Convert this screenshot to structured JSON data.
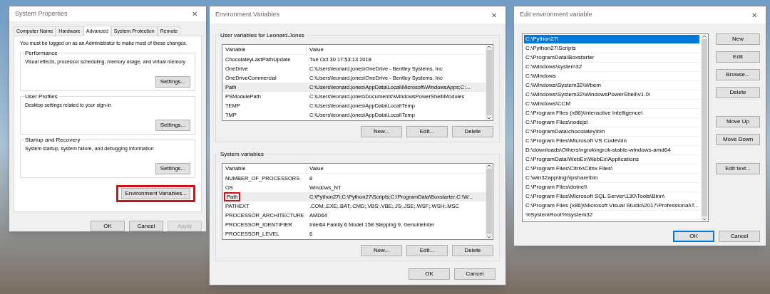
{
  "system_properties": {
    "title": "System Properties",
    "close": "✕",
    "tabs": [
      {
        "label": "Computer Name",
        "selected": false
      },
      {
        "label": "Hardware",
        "selected": false
      },
      {
        "label": "Advanced",
        "selected": true
      },
      {
        "label": "System Protection",
        "selected": false
      },
      {
        "label": "Remote",
        "selected": false
      }
    ],
    "note": "You must be logged on as an Administrator to make most of these changes.",
    "groups": [
      {
        "title": "Performance",
        "description": "Visual effects, processor scheduling, memory usage, and virtual memory",
        "button": "Settings..."
      },
      {
        "title": "User Profiles",
        "description": "Desktop settings related to your sign-in",
        "button": "Settings..."
      },
      {
        "title": "Startup and Recovery",
        "description": "System startup, system failure, and debugging information",
        "button": "Settings..."
      }
    ],
    "env_button": {
      "label": "Environment Variables...",
      "highlighted": true
    },
    "buttons": [
      {
        "label": "OK",
        "disabled": false
      },
      {
        "label": "Cancel",
        "disabled": false
      },
      {
        "label": "Apply",
        "disabled": true
      }
    ]
  },
  "environment_variables": {
    "title": "Environment Variables",
    "close": "✕",
    "sections": [
      {
        "title": "User variables for Leonard.Jones",
        "columns": [
          "Variable",
          "Value"
        ],
        "rows": [
          {
            "variable": "ChocolateyLastPathUpdate",
            "value": "Tue Oct 30 17:53:13 2018",
            "selected": false,
            "highlighted": false
          },
          {
            "variable": "OneDrive",
            "value": "C:\\Users\\leonard.jones\\OneDrive - Bentley Systems, Inc",
            "selected": false,
            "highlighted": false
          },
          {
            "variable": "OneDriveCommercial",
            "value": "C:\\Users\\leonard.jones\\OneDrive - Bentley Systems, Inc",
            "selected": false,
            "highlighted": false
          },
          {
            "variable": "Path",
            "value": "C:\\Users\\leonard.jones\\AppData\\Local\\Microsoft\\WindowsApps;C:...",
            "selected": true,
            "highlighted": false
          },
          {
            "variable": "PSModulePath",
            "value": "C:\\Users\\leonard.jones\\Documents\\WindowsPowerShell\\Modules",
            "selected": false,
            "highlighted": false
          },
          {
            "variable": "TEMP",
            "value": "C:\\Users\\leonard.jones\\AppData\\Local\\Temp",
            "selected": false,
            "highlighted": false
          },
          {
            "variable": "TMP",
            "value": "C:\\Users\\leonard.jones\\AppData\\Local\\Temp",
            "selected": false,
            "highlighted": false
          }
        ],
        "buttons": [
          "New...",
          "Edit...",
          "Delete"
        ]
      },
      {
        "title": "System variables",
        "columns": [
          "Variable",
          "Value"
        ],
        "rows": [
          {
            "variable": "NUMBER_OF_PROCESSORS",
            "value": "8",
            "selected": false,
            "highlighted": false
          },
          {
            "variable": "OS",
            "value": "Windows_NT",
            "selected": false,
            "highlighted": false
          },
          {
            "variable": "Path",
            "value": "C:\\Python27\\;C:\\Python27\\Scripts;C:\\ProgramData\\Boxstarter;C:\\W...",
            "selected": true,
            "highlighted": true
          },
          {
            "variable": "PATHEXT",
            "value": ".COM;.EXE;.BAT;.CMD;.VBS;.VBE;.JS;.JSE;.WSF;.WSH;.MSC",
            "selected": false,
            "highlighted": false
          },
          {
            "variable": "PROCESSOR_ARCHITECTURE",
            "value": "AMD64",
            "selected": false,
            "highlighted": false
          },
          {
            "variable": "PROCESSOR_IDENTIFIER",
            "value": "Intel64 Family 6 Model 158 Stepping 9, GenuineIntel",
            "selected": false,
            "highlighted": false
          },
          {
            "variable": "PROCESSOR_LEVEL",
            "value": "6",
            "selected": false,
            "highlighted": false
          }
        ],
        "buttons": [
          "New...",
          "Edit...",
          "Delete"
        ]
      }
    ],
    "buttons": [
      "OK",
      "Cancel"
    ]
  },
  "edit_variable": {
    "title": "Edit environment variable",
    "close": "✕",
    "items": [
      {
        "text": "C:\\Python27\\",
        "selected": true
      },
      {
        "text": "C:\\Python27\\Scripts",
        "selected": false
      },
      {
        "text": "C:\\ProgramData\\Boxstarter",
        "selected": false
      },
      {
        "text": "C:\\Windows\\system32",
        "selected": false
      },
      {
        "text": "C:\\Windows",
        "selected": false
      },
      {
        "text": "C:\\Windows\\System32\\Wbem",
        "selected": false
      },
      {
        "text": "C:\\Windows\\System32\\WindowsPowerShell\\v1.0\\",
        "selected": false
      },
      {
        "text": "C:\\Windows\\CCM",
        "selected": false
      },
      {
        "text": "C:\\Program Files (x86)\\Interactive Intelligence\\",
        "selected": false
      },
      {
        "text": "C:\\Program Files\\nodejs\\",
        "selected": false
      },
      {
        "text": "C:\\ProgramData\\chocolatey\\bin",
        "selected": false
      },
      {
        "text": "C:\\Program Files\\Microsoft VS Code\\bin",
        "selected": false
      },
      {
        "text": "D:\\downloads\\Others\\ngrok\\ngrok-stable-windows-amd64",
        "selected": false
      },
      {
        "text": "C:\\ProgramData\\WebEx\\WebEx\\Applications",
        "selected": false
      },
      {
        "text": "C:\\Program Files\\Citrix\\Citrix Files\\",
        "selected": false
      },
      {
        "text": "C:\\win32app\\ingr\\ipshare\\bin",
        "selected": false
      },
      {
        "text": "C:\\Program Files\\dotnet\\",
        "selected": false
      },
      {
        "text": "C:\\Program Files\\Microsoft SQL Server\\130\\Tools\\Binn\\",
        "selected": false
      },
      {
        "text": "C:\\Program Files (x86)\\Microsoft Visual Studio\\2017\\Professional\\T...",
        "selected": false
      },
      {
        "text": "%SystemRoot%\\system32",
        "selected": false
      }
    ],
    "side_button_groups": [
      [
        "New",
        "Edit",
        "Browse...",
        "Delete"
      ],
      [
        "Move Up",
        "Move Down"
      ],
      [
        "Edit text..."
      ]
    ],
    "buttons": [
      {
        "label": "OK",
        "default": true
      },
      {
        "label": "Cancel",
        "default": false
      }
    ]
  }
}
